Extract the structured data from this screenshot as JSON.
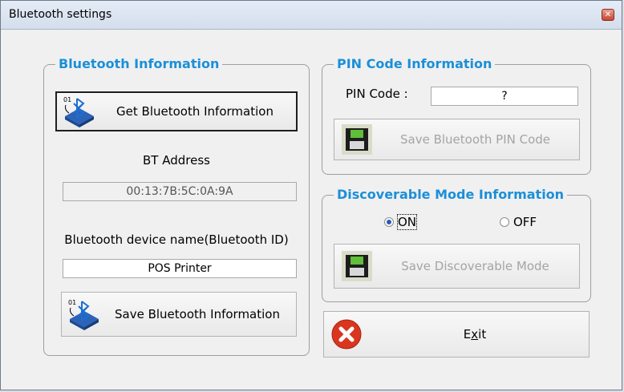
{
  "window": {
    "title": "Bluetooth settings",
    "close_glyph": "✕"
  },
  "bt_info": {
    "legend": "Bluetooth Information",
    "get_button": "Get Bluetooth Information",
    "bt_address_label": "BT Address",
    "bt_address_value": "00:13:7B:5C:0A:9A",
    "device_name_label": "Bluetooth device name(Bluetooth ID)",
    "device_name_value": "POS Printer",
    "save_button": "Save Bluetooth Information"
  },
  "pin_info": {
    "legend": "PIN Code Information",
    "pin_label": "PIN Code :",
    "pin_value": "?",
    "save_button": "Save Bluetooth PIN Code"
  },
  "discoverable": {
    "legend": "Discoverable Mode Information",
    "on_label": "ON",
    "off_label": "OFF",
    "selected": "ON",
    "save_button": "Save Discoverable Mode"
  },
  "exit": {
    "label_prefix": "E",
    "label_mnemonic": "x",
    "label_suffix": "it"
  },
  "icons": {
    "bluetooth": "bluetooth-icon",
    "save": "floppy-disk-icon",
    "exit": "exit-x-icon"
  },
  "colors": {
    "legend": "#1b8fd8",
    "exit_red": "#d9351f"
  }
}
